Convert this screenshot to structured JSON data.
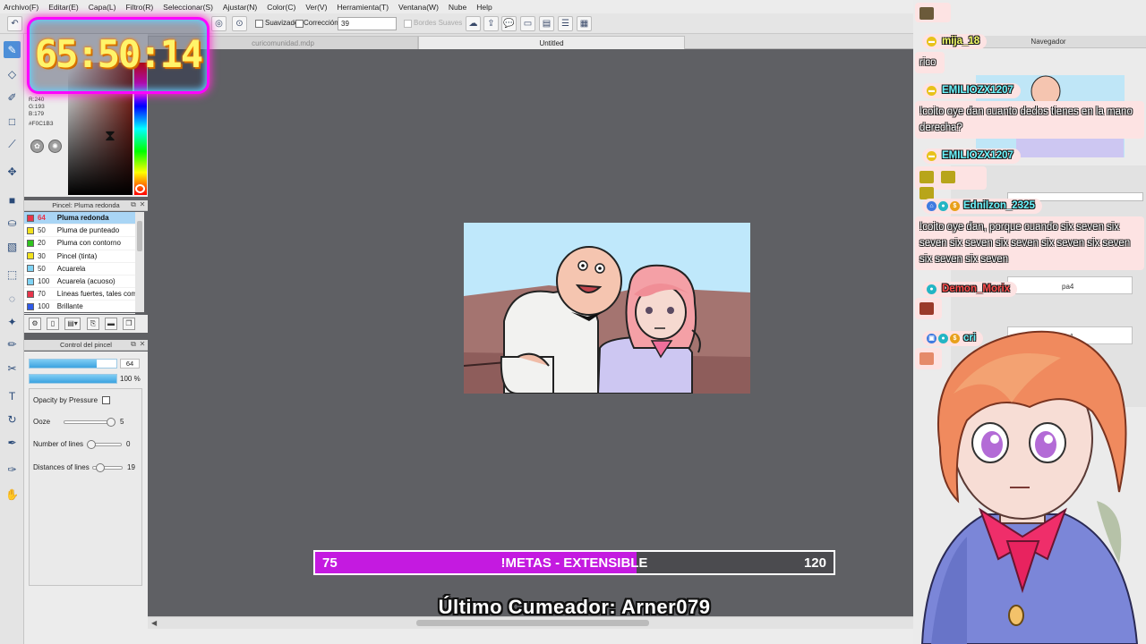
{
  "menu": [
    "Archivo(F)",
    "Editar(E)",
    "Capa(L)",
    "Filtro(R)",
    "Seleccionar(S)",
    "Ajustar(N)",
    "Color(C)",
    "Ver(V)",
    "Herramienta(T)",
    "Ventana(W)",
    "Nube",
    "Help"
  ],
  "toolbar": {
    "smoothing_label": "Suavizado",
    "correction_label": "Corrección",
    "correction_value": "39",
    "soft_edges_label": "Bordes Suaves"
  },
  "tabs": [
    "curicomunidad.mdp",
    "Untitled"
  ],
  "color": {
    "r": "R:240",
    "g": "G:193",
    "b": "B:179",
    "hex": "#F0C1B3"
  },
  "timer": "65:50:14",
  "brush_panel": {
    "title": "Pincel: Pluma redonda",
    "brushes": [
      {
        "size": "64",
        "name": "Pluma redonda",
        "color": "#e8344a",
        "selected": true
      },
      {
        "size": "50",
        "name": "Pluma de punteado",
        "color": "#f2e21c",
        "selected": false
      },
      {
        "size": "20",
        "name": "Pluma con contorno",
        "color": "#2fc41d",
        "selected": false
      },
      {
        "size": "30",
        "name": "Pincel (tinta)",
        "color": "#f2e21c",
        "selected": false
      },
      {
        "size": "50",
        "name": "Acuarela",
        "color": "#7fd3f5",
        "selected": false
      },
      {
        "size": "100",
        "name": "Acuarela (acuoso)",
        "color": "#7fd3f5",
        "selected": false
      },
      {
        "size": "70",
        "name": "Líneas fuertes, tales como",
        "color": "#e8344a",
        "selected": false
      },
      {
        "size": "100",
        "name": "Brillante",
        "color": "#2f5ae8",
        "selected": false
      }
    ]
  },
  "brush_control": {
    "title": "Control del pincel",
    "size_value": "64",
    "size_fill": 0.77,
    "opacity_value": "100 %",
    "opacity_fill": 1.0,
    "opacity_pressure_label": "Opacity by Pressure",
    "ooze_label": "Ooze",
    "ooze_value": "5",
    "lines_label": "Number of lines",
    "lines_value": "0",
    "distance_label": "Distances of lines",
    "distance_value": "19"
  },
  "navigator": {
    "title": "Navegador"
  },
  "layers": {
    "row1": "pa4",
    "row2": "pa1"
  },
  "chat": [
    {
      "user": "",
      "text": ""
    },
    {
      "user": "mija_18",
      "text": "rico"
    },
    {
      "user": "EMILIOZX1207",
      "text": "!coito oye dan cuanto dedos tienes en la mano derecha?"
    },
    {
      "user": "EMILIOZX1207",
      "text": ""
    },
    {
      "user": "Ednilzon_2325",
      "text": "!coito oye dan, porque cuando six seven six seven six seven six seven six seven six seven six seven six seven"
    },
    {
      "user": "Demon_Morix",
      "text": ""
    },
    {
      "user": "cri",
      "text": ""
    }
  ],
  "goal": {
    "start": "75",
    "label": "!METAS - EXTENSIBLE",
    "end": "120",
    "fill": 0.62
  },
  "caption": "Último Cumeador: Arner079",
  "colors": {
    "goal_fill": "#c41ae0",
    "chat_bg": "#fde3e3",
    "timer_glow": "#ff2bd2",
    "timer_text": "#fff46a",
    "active_tool": "#4d8fd8"
  }
}
